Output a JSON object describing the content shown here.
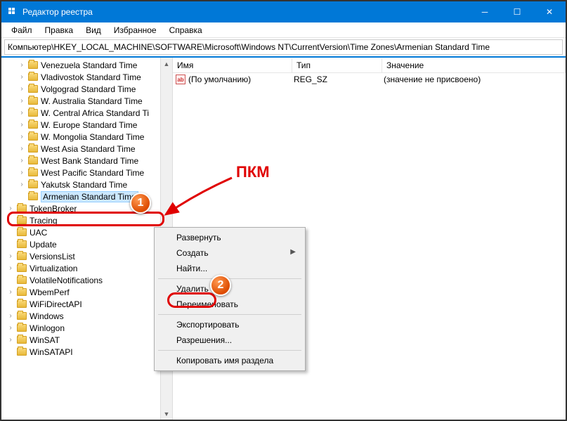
{
  "titlebar": {
    "title": "Редактор реестра"
  },
  "menu": {
    "file": "Файл",
    "edit": "Правка",
    "view": "Вид",
    "fav": "Избранное",
    "help": "Справка"
  },
  "path": "Компьютер\\HKEY_LOCAL_MACHINE\\SOFTWARE\\Microsoft\\Windows NT\\CurrentVersion\\Time Zones\\Armenian Standard Time",
  "tree": {
    "items": [
      "Venezuela Standard Time",
      "Vladivostok Standard Time",
      "Volgograd Standard Time",
      "W. Australia Standard Time",
      "W. Central Africa Standard Ti",
      "W. Europe Standard Time",
      "W. Mongolia Standard Time",
      "West Asia Standard Time",
      "West Bank Standard Time",
      "West Pacific Standard Time",
      "Yakutsk Standard Time",
      "Armenian Standard Time"
    ],
    "after": [
      "TokenBroker",
      "Tracing",
      "UAC",
      "Update",
      "VersionsList",
      "Virtualization",
      "VolatileNotifications",
      "WbemPerf",
      "WiFiDirectAPI",
      "Windows",
      "Winlogon",
      "WinSAT",
      "WinSATAPI"
    ]
  },
  "list": {
    "headers": {
      "name": "Имя",
      "type": "Тип",
      "value": "Значение"
    },
    "row": {
      "name": "(По умолчанию)",
      "type": "REG_SZ",
      "value": "(значение не присвоено)"
    }
  },
  "context": {
    "expand": "Развернуть",
    "new": "Создать",
    "find": "Найти...",
    "delete": "Удалить",
    "rename": "Переименовать",
    "export": "Экспортировать",
    "perm": "Разрешения...",
    "copykey": "Копировать имя раздела"
  },
  "annotation": {
    "pkm": "ПКМ",
    "badge1": "1",
    "badge2": "2"
  }
}
